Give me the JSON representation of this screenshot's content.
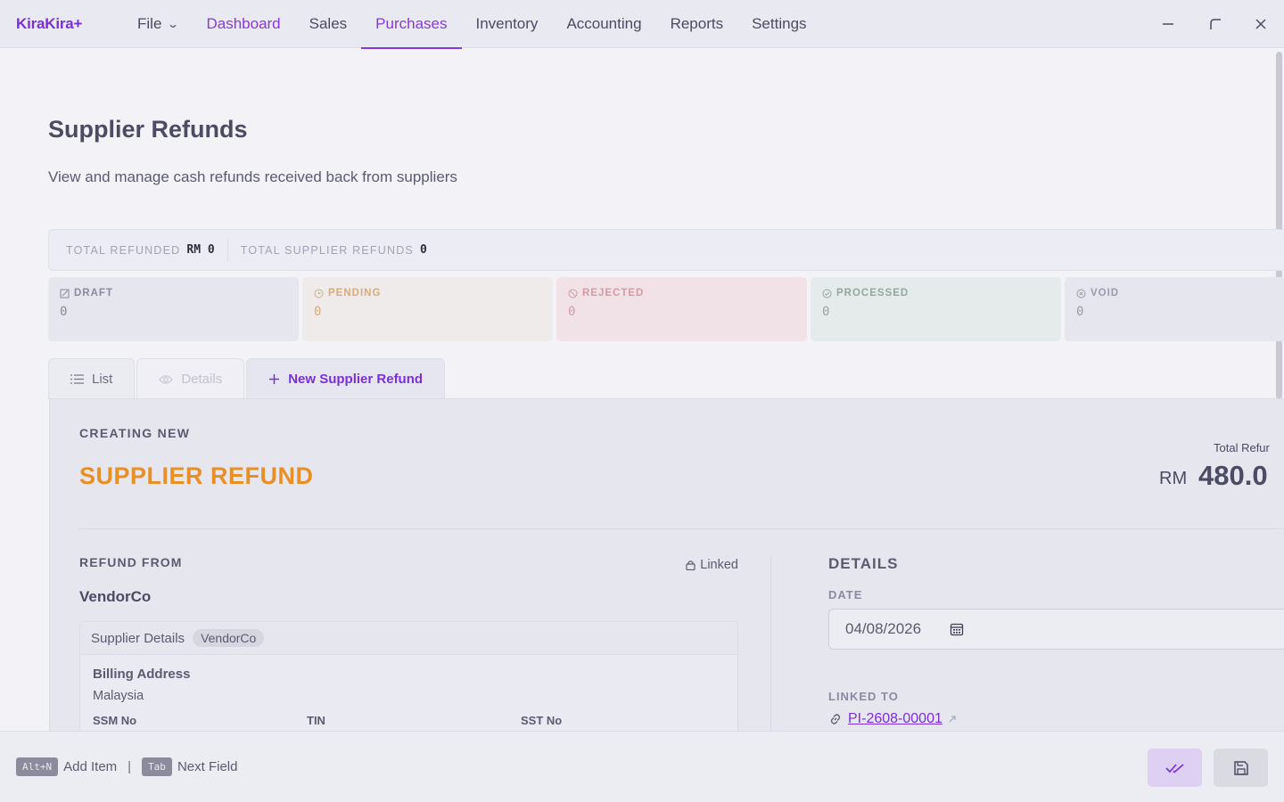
{
  "app": {
    "brand": "KiraKira+"
  },
  "nav": {
    "file": "File",
    "items": [
      "Dashboard",
      "Sales",
      "Purchases",
      "Inventory",
      "Accounting",
      "Reports",
      "Settings"
    ]
  },
  "page": {
    "title": "Supplier Refunds",
    "subtitle": "View and manage cash refunds received back from suppliers"
  },
  "totals": {
    "refunded_label": "TOTAL REFUNDED",
    "refunded_value": "RM 0",
    "count_label": "TOTAL SUPPLIER REFUNDS",
    "count_value": "0"
  },
  "statuses": [
    {
      "label": "DRAFT",
      "value": "0",
      "icon": "edit-icon"
    },
    {
      "label": "PENDING",
      "value": "0",
      "icon": "clock-icon"
    },
    {
      "label": "REJECTED",
      "value": "0",
      "icon": "block-icon"
    },
    {
      "label": "PROCESSED",
      "value": "0",
      "icon": "check-circle-icon"
    },
    {
      "label": "VOID",
      "value": "0",
      "icon": "x-circle-icon"
    }
  ],
  "tabs": {
    "list": "List",
    "details": "Details",
    "new": "New Supplier Refund"
  },
  "form": {
    "creating_label": "CREATING NEW",
    "doc_type": "SUPPLIER REFUND",
    "total_label": "Total Refur",
    "total_currency": "RM",
    "total_value": "480.0",
    "refund_from_label": "REFUND FROM",
    "linked_label": "Linked",
    "supplier_name": "VendorCo",
    "supplier_details_label": "Supplier Details",
    "supplier_chip": "VendorCo",
    "billing_address_label": "Billing Address",
    "billing_address_value": "Malaysia",
    "ssm_label": "SSM No",
    "tin_label": "TIN",
    "sst_label": "SST No",
    "details_label": "DETAILS",
    "date_label": "DATE",
    "date_value": "04/08/2026",
    "linked_to_label": "LINKED TO",
    "linked_to_value": "PI-2608-00001"
  },
  "footer": {
    "hint1_key": "Alt+N",
    "hint1_text": "Add Item",
    "hint2_key": "Tab",
    "hint2_text": "Next Field"
  },
  "colors": {
    "accent": "#7b2fd6",
    "doc_type": "#e88f26"
  }
}
